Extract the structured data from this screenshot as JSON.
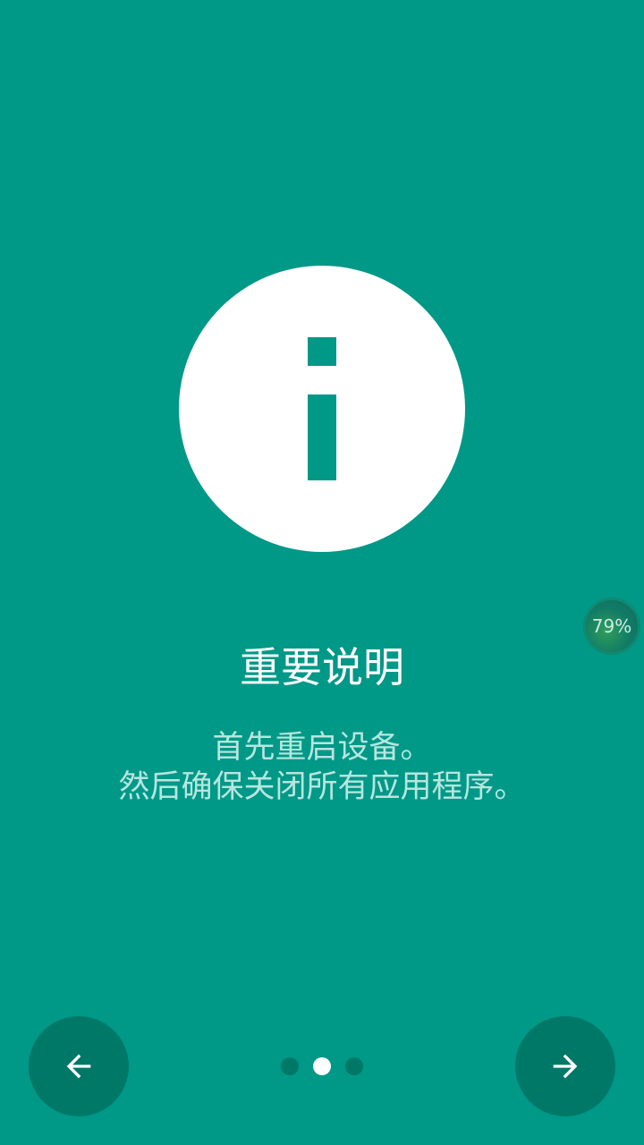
{
  "intro": {
    "title": "重要说明",
    "body_lines": [
      "首先重启设备。",
      "然后确保关闭所有应用程序。"
    ]
  },
  "overlay": {
    "percent_label": "79%"
  },
  "pager": {
    "page_count": 3,
    "active_index": 1
  },
  "navigation": {
    "prev_icon": "arrow-left-icon",
    "next_icon": "arrow-right-icon"
  },
  "theme": {
    "background": "#009887",
    "button": "#007868",
    "accent": "#ffffff",
    "body_text": "#b7e6df"
  }
}
